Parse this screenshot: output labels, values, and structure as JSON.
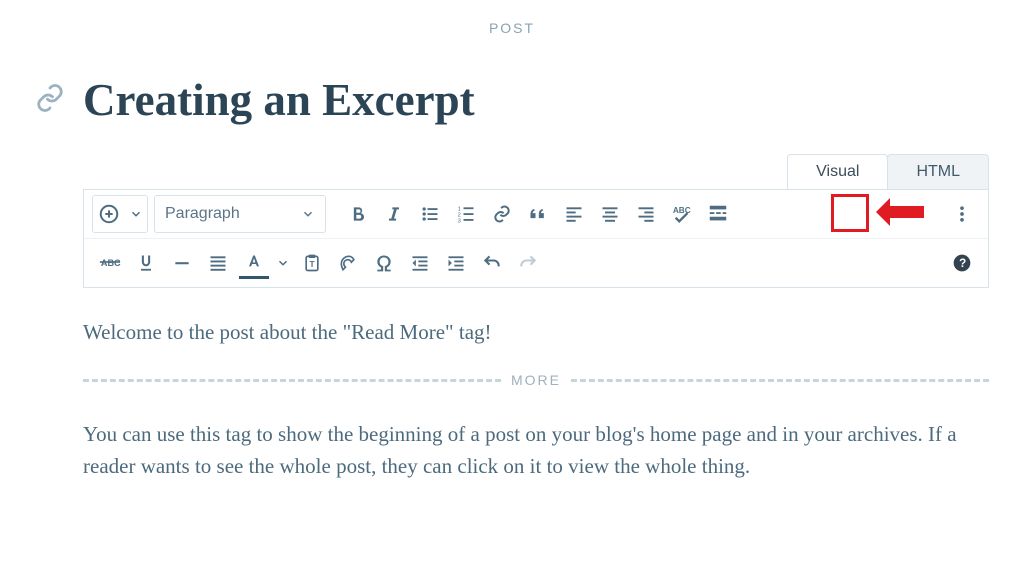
{
  "post_type_label": "POST",
  "title": "Creating an Excerpt",
  "tabs": {
    "visual": "Visual",
    "html": "HTML"
  },
  "block_format": "Paragraph",
  "more_divider_label": "MORE",
  "paragraphs": {
    "intro": "Welcome to the post about the \"Read More\" tag!",
    "explain": "You can use this tag to show the beginning of a post on your blog's home page and in your archives. If a reader wants to see the whole post, they can click on it to view the whole thing."
  },
  "icons": {
    "permalink": "link-icon",
    "add": "add-icon",
    "add_menu": "chevron-down-icon",
    "bold": "bold-icon",
    "italic": "italic-icon",
    "ul": "list-ul-icon",
    "ol": "list-ol-icon",
    "link": "link-icon",
    "quote": "quote-icon",
    "align_l": "align-left-icon",
    "align_c": "align-center-icon",
    "align_r": "align-right-icon",
    "spell": "spellcheck-icon",
    "readmore": "read-more-icon",
    "kebab": "more-icon",
    "strike": "strikethrough-icon",
    "underline": "underline-icon",
    "hr": "horizontal-rule-icon",
    "justify": "align-justify-icon",
    "textcolor": "text-color-icon",
    "textcolor_menu": "chevron-down-icon",
    "paste": "paste-plain-icon",
    "clearfmt": "clear-format-icon",
    "omega": "special-char-icon",
    "outdent": "outdent-icon",
    "indent": "indent-icon",
    "undo": "undo-icon",
    "redo": "redo-icon",
    "help": "help-icon"
  }
}
